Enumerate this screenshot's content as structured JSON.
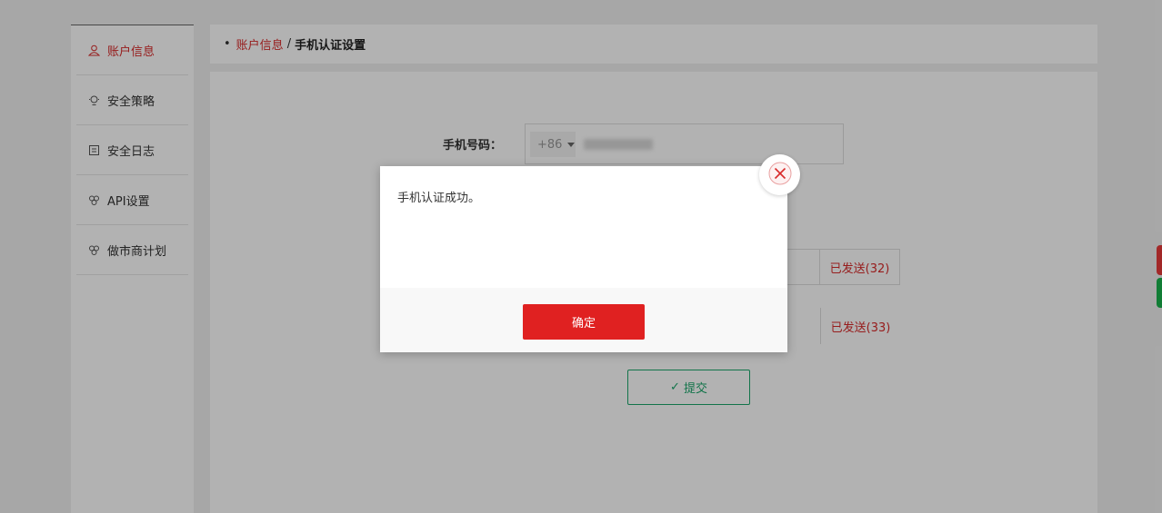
{
  "sidebar": {
    "items": [
      {
        "label": "账户信息",
        "icon": "user-icon",
        "active": true
      },
      {
        "label": "安全策略",
        "icon": "lightbulb-icon",
        "active": false
      },
      {
        "label": "安全日志",
        "icon": "document-icon",
        "active": false
      },
      {
        "label": "API设置",
        "icon": "api-icon",
        "active": false
      },
      {
        "label": "做市商计划",
        "icon": "market-maker-icon",
        "active": false
      }
    ]
  },
  "breadcrumb": {
    "bullet": "•",
    "parent": "账户信息",
    "separator": "/",
    "current": "手机认证设置"
  },
  "form": {
    "phone_label": "手机号码：",
    "country_code": "+86",
    "code_rows": [
      {
        "sent_text": "已发送(32)"
      },
      {
        "sent_text": "已发送(33)"
      }
    ],
    "submit_label": "提交"
  },
  "dialog": {
    "message": "手机认证成功。",
    "ok_label": "确定"
  },
  "colors": {
    "accent": "#d82a2a",
    "button_red": "#e02121",
    "submit_green": "#1aa66a",
    "side_red": "#e83a3a",
    "side_green": "#19b44d"
  }
}
